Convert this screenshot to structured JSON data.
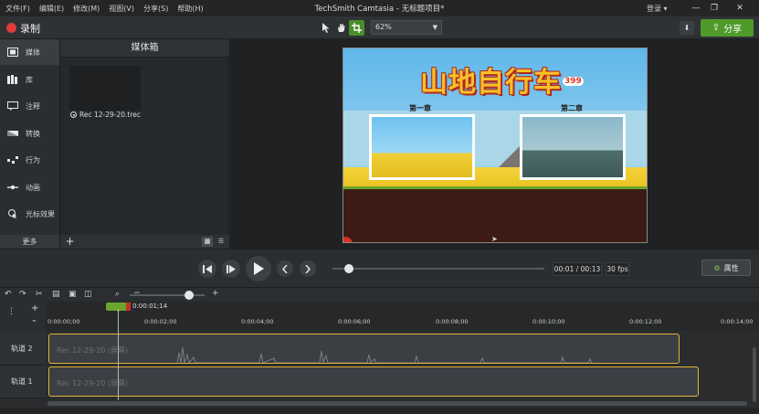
{
  "menubar": {
    "menus": [
      "文件(F)",
      "编辑(E)",
      "修改(M)",
      "视图(V)",
      "分享(S)",
      "帮助(H)"
    ],
    "window_title": "TechSmith Camtasia - 无标题项目*",
    "login": "登录 ▾",
    "minimize": "—",
    "restore": "❐",
    "close": "✕"
  },
  "toolbar": {
    "record_label": "录制",
    "zoom_value": "62%",
    "share_label": "分享"
  },
  "leftnav": {
    "items": [
      {
        "label": "媒体",
        "icon": "film-icon"
      },
      {
        "label": "库",
        "icon": "library-icon"
      },
      {
        "label": "注释",
        "icon": "annotation-icon"
      },
      {
        "label": "转换",
        "icon": "transition-icon"
      },
      {
        "label": "行为",
        "icon": "behavior-icon"
      },
      {
        "label": "动画",
        "icon": "animation-icon"
      },
      {
        "label": "光标效果",
        "icon": "cursor-effect-icon"
      }
    ],
    "more_label": "更多"
  },
  "mediabin": {
    "title": "媒体箱",
    "file_name": "Rec 12-29-20.trec"
  },
  "video": {
    "game_title": "山地自行车",
    "brand": "399",
    "chapter1": "第一章",
    "chapter2": "第二章"
  },
  "playback": {
    "time": "00:01 / 00:13",
    "fps": "30 fps",
    "properties_label": "属性",
    "progress_fraction": 0.077
  },
  "timeline": {
    "playhead_time": "0:00:01;14",
    "ruler": [
      "0:00:00;00",
      "0:00:02;00",
      "0:00:04;00",
      "0:00:06;00",
      "0:00:08;00",
      "0:00:10;00",
      "0:00:12;00",
      "0:00:14;00"
    ],
    "tracks": [
      {
        "name": "轨道 2",
        "clip_label": "Rec 12-29-20 (屏幕)"
      },
      {
        "name": "轨道 1",
        "clip_label": "Rec 12-29-20 (屏幕)"
      }
    ]
  },
  "colors": {
    "accent_green": "#4f9a2a",
    "record_red": "#e03a3a",
    "clip_border": "#e0b43a"
  }
}
